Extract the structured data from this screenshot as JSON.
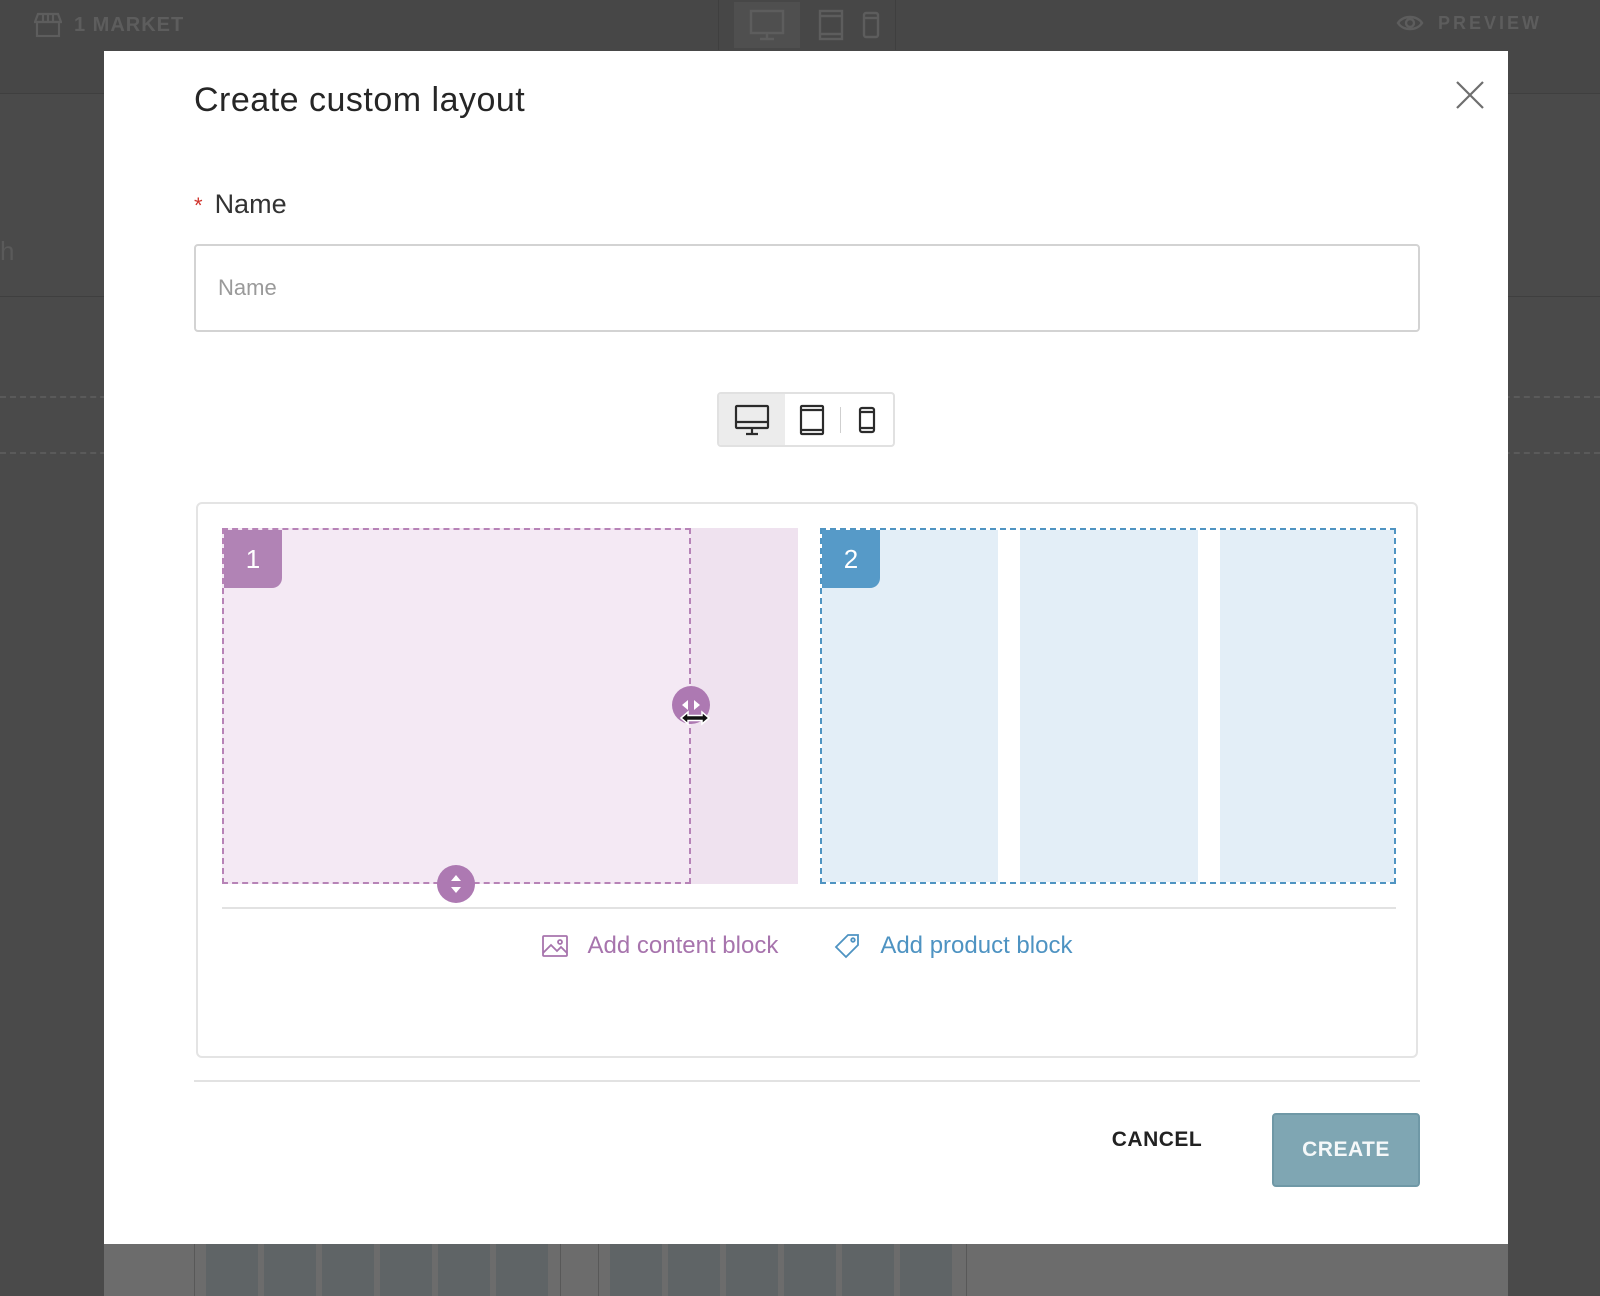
{
  "background": {
    "market_label": "1 MARKET",
    "preview_label": "PREVIEW",
    "left_fragment": "h"
  },
  "modal": {
    "title": "Create custom layout",
    "name_field": {
      "required_mark": "*",
      "label": "Name",
      "placeholder": "Name",
      "value": ""
    },
    "device_toggle": {
      "options": [
        "desktop-icon",
        "tablet-icon",
        "mobile-icon"
      ],
      "selected": "desktop-icon"
    },
    "blocks": [
      {
        "number": "1",
        "kind": "content",
        "color": "#b183b5"
      },
      {
        "number": "2",
        "kind": "product",
        "color": "#569ac8"
      }
    ],
    "add_content_label": "Add content block",
    "add_product_label": "Add product block",
    "cancel_label": "CANCEL",
    "create_label": "CREATE"
  },
  "colors": {
    "content_accent": "#a774ad",
    "product_accent": "#4e93c2",
    "create_button": "#7fa6b3",
    "required": "#d0342c"
  }
}
